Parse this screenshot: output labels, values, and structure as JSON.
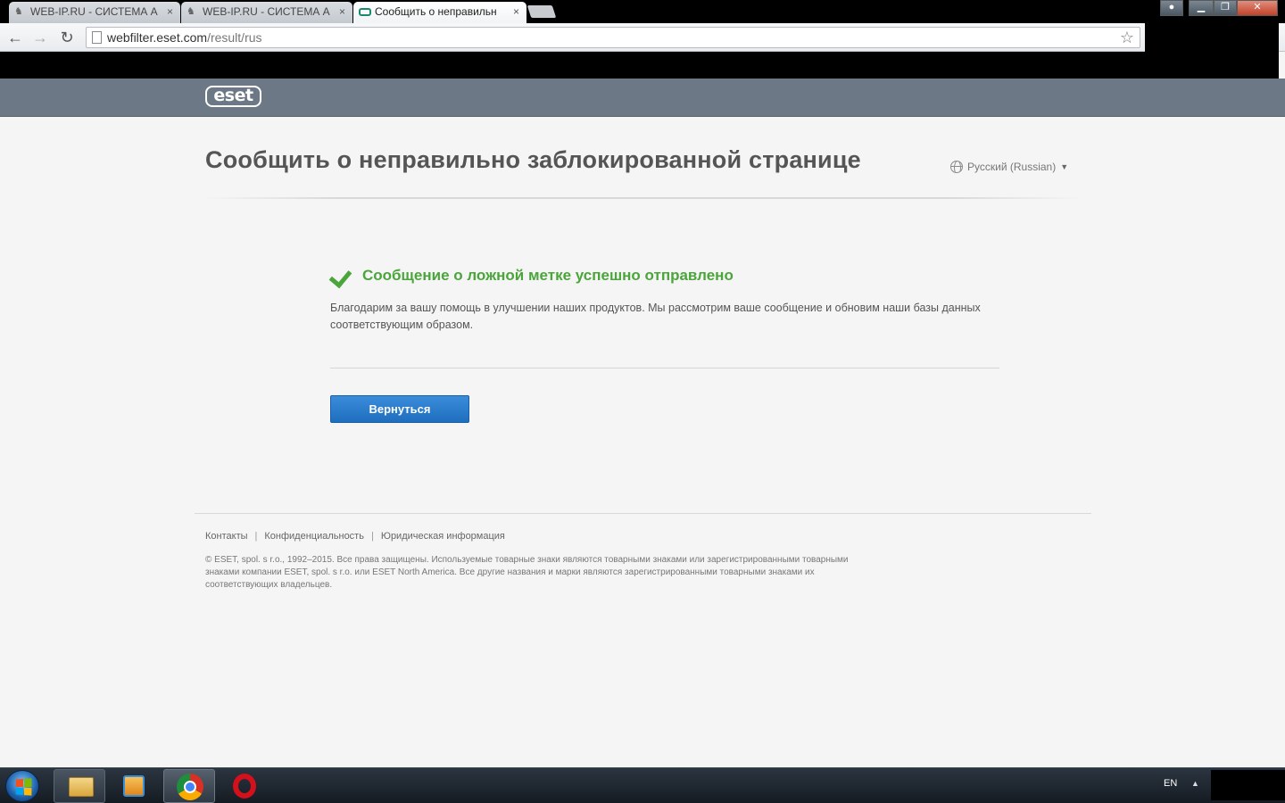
{
  "browser": {
    "tabs": [
      {
        "title": "WEB-IP.RU - СИСТЕМА А",
        "active": false
      },
      {
        "title": "WEB-IP.RU - СИСТЕМА А",
        "active": false
      },
      {
        "title": "Сообщить о неправильн",
        "active": true
      }
    ],
    "tab_close_glyph": "×",
    "url_host": "webfilter.eset.com",
    "url_path": "/result/rus",
    "window_buttons": {
      "minimize": "▁",
      "maximize": "❐",
      "close": "✕"
    }
  },
  "header": {
    "logo_text": "eset"
  },
  "page": {
    "title": "Сообщить о неправильно заблокированной странице",
    "language": "Русский (Russian)",
    "success_message": "Сообщение о ложной метке успешно отправлено",
    "description": "Благодарим за вашу помощь в улучшении наших продуктов. Мы рассмотрим ваше сообщение и обновим наши базы данных соответствующим образом.",
    "back_button": "Вернуться"
  },
  "footer": {
    "links": [
      "Контакты",
      "Конфиденциальность",
      "Юридическая информация"
    ],
    "separator": "|",
    "copyright": "© ESET, spol. s r.o., 1992–2015. Все права защищены. Используемые товарные знаки являются товарными знаками или зарегистрированными товарными знаками компании ESET, spol. s r.o. или ESET North America. Все другие названия и марки являются зарегистрированными товарными знаками их соответствующих владельцев."
  },
  "taskbar": {
    "language": "EN",
    "tray_arrow": "▲"
  },
  "colors": {
    "success_green": "#4aa53a",
    "button_blue": "#2b7fd2",
    "header_gray": "#6d7886"
  }
}
